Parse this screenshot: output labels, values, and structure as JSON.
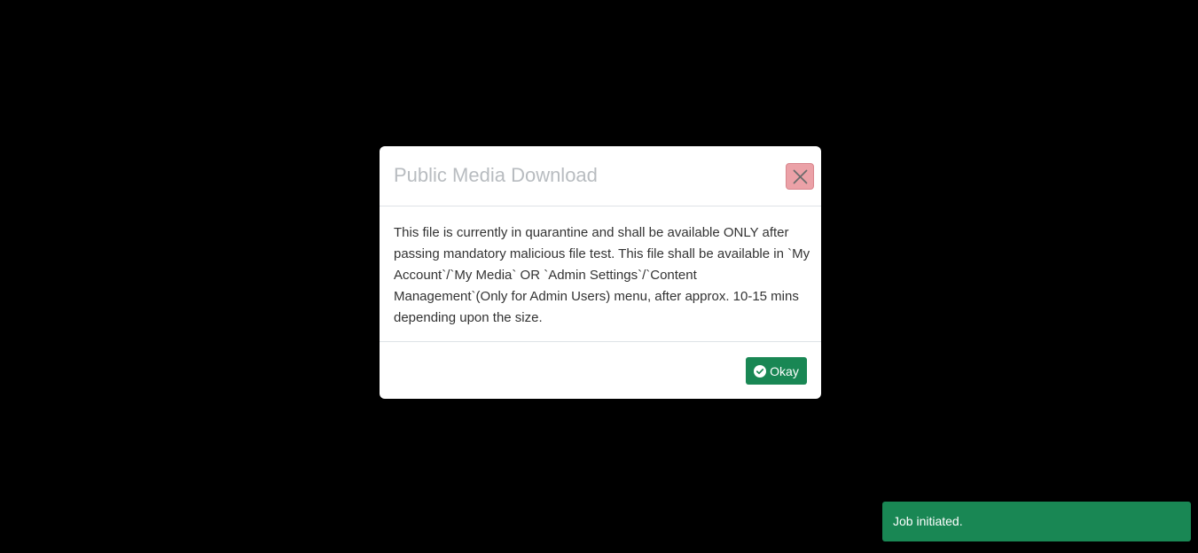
{
  "modal": {
    "title": "Public Media Download",
    "close_icon": "close-icon",
    "message": "This file is currently in quarantine and shall be available ONLY after passing mandatory malicious file test. This file shall be available in `My Account`/`My Media` OR `Admin Settings`/`Content Management`(Only for Admin Users) menu, after approx. 10-15 mins depending upon the size.",
    "okay_label": "Okay",
    "okay_icon": "check-circle-icon"
  },
  "toast": {
    "message": "Job initiated."
  },
  "colors": {
    "backdrop": "#000000",
    "success": "#198754",
    "close_button": "#eba1a7",
    "title_text": "#b8bcc0"
  }
}
